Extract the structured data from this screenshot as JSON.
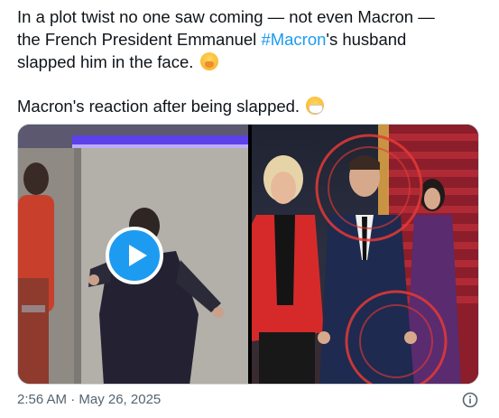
{
  "tweet": {
    "text_line1": "In a plot twist no one saw coming — not even Macron —",
    "text_line2_before": "the French President Emmanuel ",
    "hashtag": "#Macron",
    "text_line2_after": "'s husband",
    "text_line3": "slapped him in the face.",
    "text_line4": "Macron's reaction after being slapped.",
    "emoji_1": "yawning-face-emoji",
    "emoji_2": "face-with-medical-mask-emoji"
  },
  "media": {
    "left_panel": "video-thumbnail",
    "right_panel": "photo",
    "play_icon": "play-icon"
  },
  "footer": {
    "timestamp": "2:56 AM · May 26, 2025",
    "info_icon": "info-icon"
  },
  "colors": {
    "text": "#0f1419",
    "hashtag": "#1d9bf0",
    "secondary": "#536471",
    "play_button": "#1d9bf0",
    "red_jacket": "#d62a2a",
    "annotation_circle": "#e53935"
  }
}
